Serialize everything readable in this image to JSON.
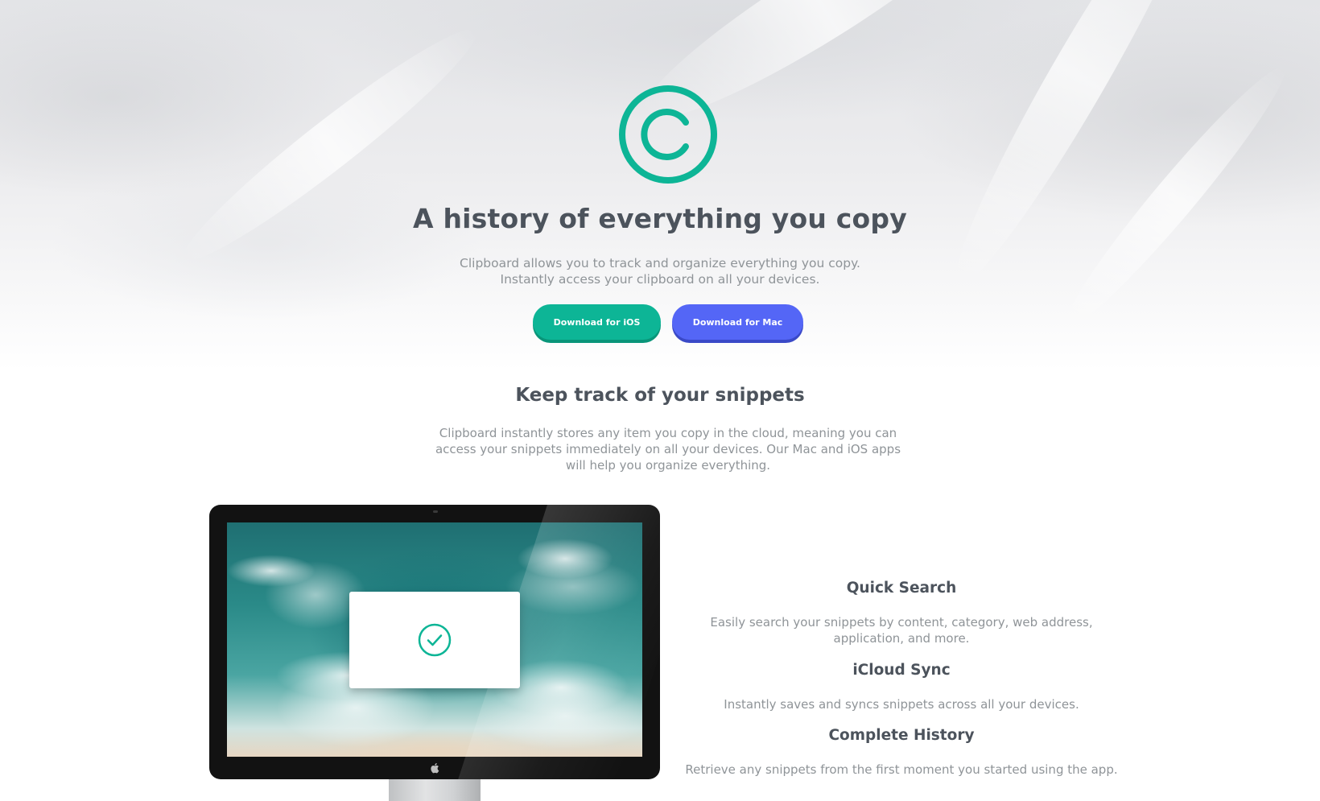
{
  "hero": {
    "title": "A history of everything you copy",
    "subtitle": "Clipboard allows you to track and organize everything you copy. Instantly access your clipboard on all your devices.",
    "buttons": {
      "ios_label": "Download for iOS",
      "mac_label": "Download for Mac"
    }
  },
  "snippets": {
    "title": "Keep track of your snippets",
    "description": "Clipboard instantly stores any item you copy in the cloud, meaning you can access your snippets immediately on all your devices. Our Mac and iOS apps will help you organize everything."
  },
  "features": [
    {
      "title": "Quick Search",
      "text": "Easily search your snippets by content, category, web address, application, and more."
    },
    {
      "title": "iCloud Sync",
      "text": "Instantly saves and syncs snippets across all your devices."
    },
    {
      "title": "Complete History",
      "text": "Retrieve any snippets from the first moment you started using the app."
    }
  ],
  "icons": {
    "logo": "copyright-logo-icon",
    "check": "check-circle-icon",
    "apple": "apple-icon"
  },
  "colors": {
    "accent_green": "#0db596",
    "accent_blue": "#5466f6",
    "heading": "#4c535c",
    "body_text": "#8f9498"
  }
}
